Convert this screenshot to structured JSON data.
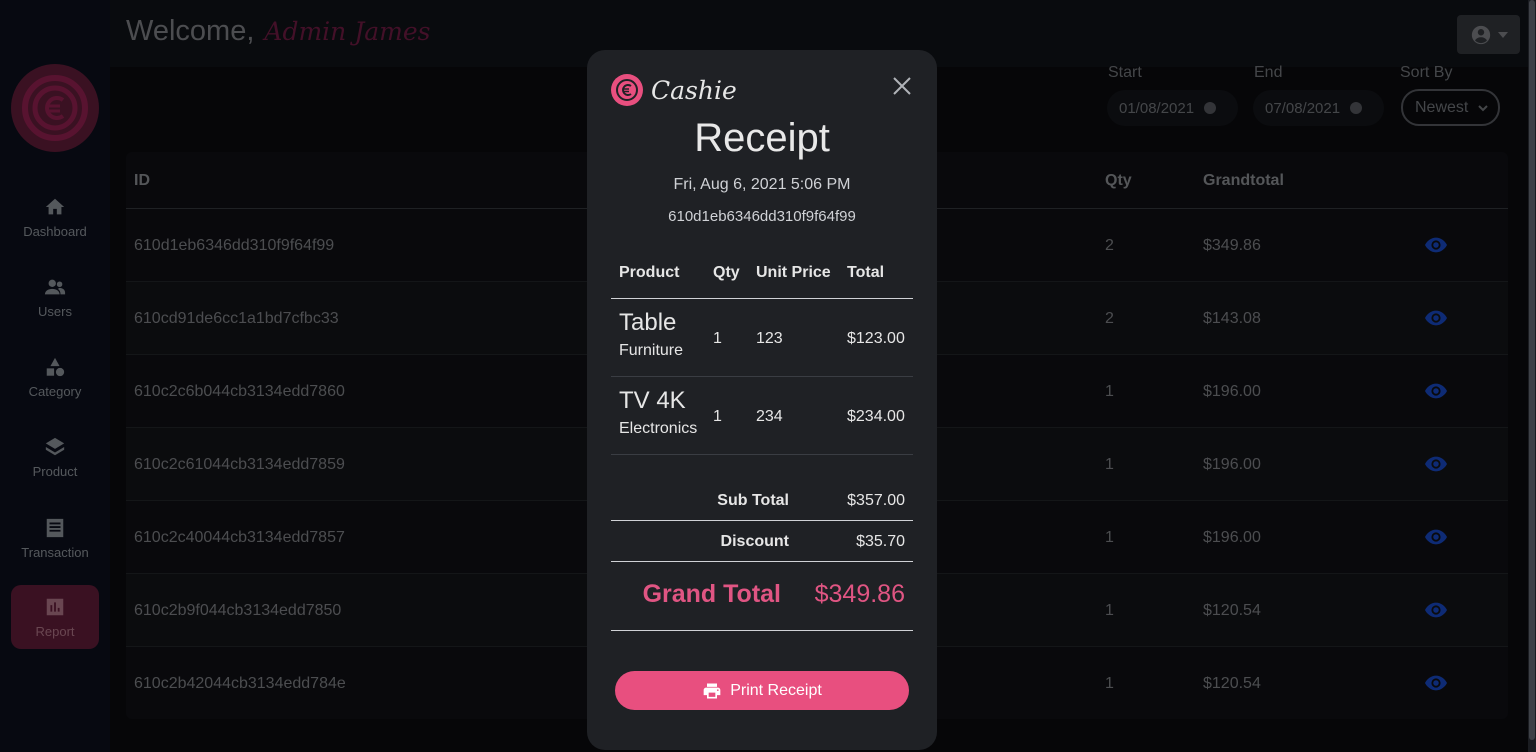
{
  "sidebar": {
    "items": [
      {
        "label": "Dashboard",
        "icon": "home-icon"
      },
      {
        "label": "Users",
        "icon": "users-icon"
      },
      {
        "label": "Category",
        "icon": "category-icon"
      },
      {
        "label": "Product",
        "icon": "layers-icon"
      },
      {
        "label": "Transaction",
        "icon": "receipt-list-icon"
      },
      {
        "label": "Report",
        "icon": "chart-icon",
        "active": true
      }
    ]
  },
  "header": {
    "welcome": "Welcome,",
    "admin_name": "Admin James"
  },
  "filters": {
    "start_label": "Start",
    "end_label": "End",
    "sort_label": "Sort By",
    "start_value": "01/08/2021",
    "end_value": "07/08/2021",
    "sort_value": "Newest"
  },
  "table": {
    "headers": {
      "id": "ID",
      "qty": "Qty",
      "grandtotal": "Grandtotal"
    },
    "rows": [
      {
        "id": "610d1eb6346dd310f9f64f99",
        "qty": "2",
        "grandtotal": "$349.86"
      },
      {
        "id": "610cd91de6cc1a1bd7cfbc33",
        "qty": "2",
        "grandtotal": "$143.08"
      },
      {
        "id": "610c2c6b044cb3134edd7860",
        "qty": "1",
        "grandtotal": "$196.00"
      },
      {
        "id": "610c2c61044cb3134edd7859",
        "qty": "1",
        "grandtotal": "$196.00"
      },
      {
        "id": "610c2c40044cb3134edd7857",
        "qty": "1",
        "grandtotal": "$196.00"
      },
      {
        "id": "610c2b9f044cb3134edd7850",
        "qty": "1",
        "grandtotal": "$120.54"
      },
      {
        "id": "610c2b42044cb3134edd784e",
        "qty": "1",
        "grandtotal": "$120.54"
      }
    ]
  },
  "modal": {
    "brand": "Cashie",
    "title": "Receipt",
    "date": "Fri, Aug 6, 2021 5:06 PM",
    "receipt_id": "610d1eb6346dd310f9f64f99",
    "headers": {
      "product": "Product",
      "qty": "Qty",
      "unit_price": "Unit Price",
      "total": "Total"
    },
    "items": [
      {
        "name": "Table",
        "category": "Furniture",
        "qty": "1",
        "unit_price": "123",
        "total": "$123.00"
      },
      {
        "name": "TV 4K",
        "category": "Electronics",
        "qty": "1",
        "unit_price": "234",
        "total": "$234.00"
      }
    ],
    "subtotal_label": "Sub Total",
    "subtotal_value": "$357.00",
    "discount_label": "Discount",
    "discount_value": "$35.70",
    "grand_label": "Grand Total",
    "grand_value": "$349.86",
    "print_label": "Print Receipt"
  },
  "colors": {
    "accent": "#e84f7f",
    "sidebar_active": "#6b1f3e",
    "eye_icon": "#1a4fd6"
  }
}
